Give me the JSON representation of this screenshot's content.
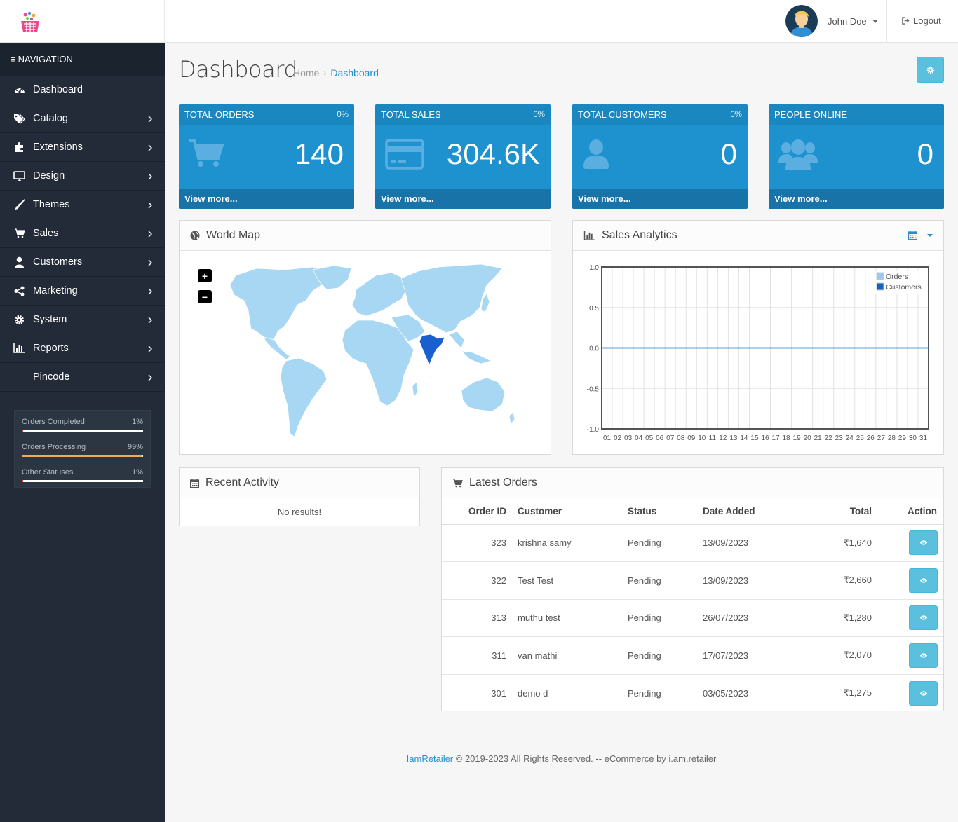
{
  "header": {
    "user_name": "John Doe",
    "logout_label": "Logout"
  },
  "sidebar": {
    "nav_title": "NAVIGATION",
    "items": [
      {
        "label": "Dashboard",
        "icon": "dashboard-icon"
      },
      {
        "label": "Catalog",
        "icon": "tags-icon"
      },
      {
        "label": "Extensions",
        "icon": "puzzle-icon"
      },
      {
        "label": "Design",
        "icon": "desktop-icon"
      },
      {
        "label": "Themes",
        "icon": "brush-icon"
      },
      {
        "label": "Sales",
        "icon": "cart-icon"
      },
      {
        "label": "Customers",
        "icon": "user-icon"
      },
      {
        "label": "Marketing",
        "icon": "share-icon"
      },
      {
        "label": "System",
        "icon": "gear-icon"
      },
      {
        "label": "Reports",
        "icon": "bar-chart-icon"
      },
      {
        "label": "Pincode",
        "icon": ""
      }
    ],
    "statuses": [
      {
        "label": "Orders Completed",
        "percent": "1%",
        "fraction": 0.01,
        "color": "#e84a3c"
      },
      {
        "label": "Orders Processing",
        "percent": "99%",
        "fraction": 0.99,
        "color": "#f0ad4e"
      },
      {
        "label": "Other Statuses",
        "percent": "1%",
        "fraction": 0.01,
        "color": "#e84a3c"
      }
    ]
  },
  "page": {
    "title": "Dashboard",
    "breadcrumb": [
      "Home",
      "Dashboard"
    ]
  },
  "tiles": [
    {
      "title": "TOTAL ORDERS",
      "percent": "0%",
      "value": "140",
      "footer": "View more...",
      "icon": "shopping-cart-icon"
    },
    {
      "title": "TOTAL SALES",
      "percent": "0%",
      "value": "304.6K",
      "footer": "View more...",
      "icon": "credit-card-icon"
    },
    {
      "title": "TOTAL CUSTOMERS",
      "percent": "0%",
      "value": "0",
      "footer": "View more...",
      "icon": "user-icon"
    },
    {
      "title": "PEOPLE ONLINE",
      "percent": "",
      "value": "0",
      "footer": "View more...",
      "icon": "users-icon"
    }
  ],
  "world_map": {
    "title": "World Map",
    "zoom_in": "+",
    "zoom_out": "−",
    "highlight_color": "#1a5fcf",
    "land_color": "#a7d7f3"
  },
  "chart_data": {
    "type": "line",
    "title": "Sales Analytics",
    "categories": [
      "01",
      "02",
      "03",
      "04",
      "05",
      "06",
      "07",
      "08",
      "09",
      "10",
      "11",
      "12",
      "13",
      "14",
      "15",
      "16",
      "17",
      "18",
      "19",
      "20",
      "21",
      "22",
      "23",
      "24",
      "25",
      "26",
      "27",
      "28",
      "29",
      "30",
      "31"
    ],
    "series": [
      {
        "name": "Orders",
        "color": "#9ac9ef",
        "values": [
          0,
          0,
          0,
          0,
          0,
          0,
          0,
          0,
          0,
          0,
          0,
          0,
          0,
          0,
          0,
          0,
          0,
          0,
          0,
          0,
          0,
          0,
          0,
          0,
          0,
          0,
          0,
          0,
          0,
          0,
          0
        ]
      },
      {
        "name": "Customers",
        "color": "#1065c0",
        "values": [
          0,
          0,
          0,
          0,
          0,
          0,
          0,
          0,
          0,
          0,
          0,
          0,
          0,
          0,
          0,
          0,
          0,
          0,
          0,
          0,
          0,
          0,
          0,
          0,
          0,
          0,
          0,
          0,
          0,
          0,
          0
        ]
      }
    ],
    "yticks": [
      "1.0",
      "0.5",
      "0.0",
      "-0.5",
      "-1.0"
    ],
    "ylim": [
      -1,
      1
    ],
    "grid": true,
    "legend": "top-right"
  },
  "recent_activity": {
    "title": "Recent Activity",
    "empty": "No results!"
  },
  "latest_orders": {
    "title": "Latest Orders",
    "columns": [
      "Order ID",
      "Customer",
      "Status",
      "Date Added",
      "Total",
      "Action"
    ],
    "rows": [
      {
        "id": "323",
        "customer": "krishna samy",
        "status": "Pending",
        "date": "13/09/2023",
        "total": "₹1,640"
      },
      {
        "id": "322",
        "customer": "Test Test",
        "status": "Pending",
        "date": "13/09/2023",
        "total": "₹2,660"
      },
      {
        "id": "313",
        "customer": "muthu test",
        "status": "Pending",
        "date": "26/07/2023",
        "total": "₹1,280"
      },
      {
        "id": "311",
        "customer": "van mathi",
        "status": "Pending",
        "date": "17/07/2023",
        "total": "₹2,070"
      },
      {
        "id": "301",
        "customer": "demo d",
        "status": "Pending",
        "date": "03/05/2023",
        "total": "₹1,275"
      }
    ]
  },
  "footer": {
    "brand": "IamRetailer",
    "text": " © 2019-2023 All Rights Reserved. -- eCommerce by i.am.retailer"
  }
}
